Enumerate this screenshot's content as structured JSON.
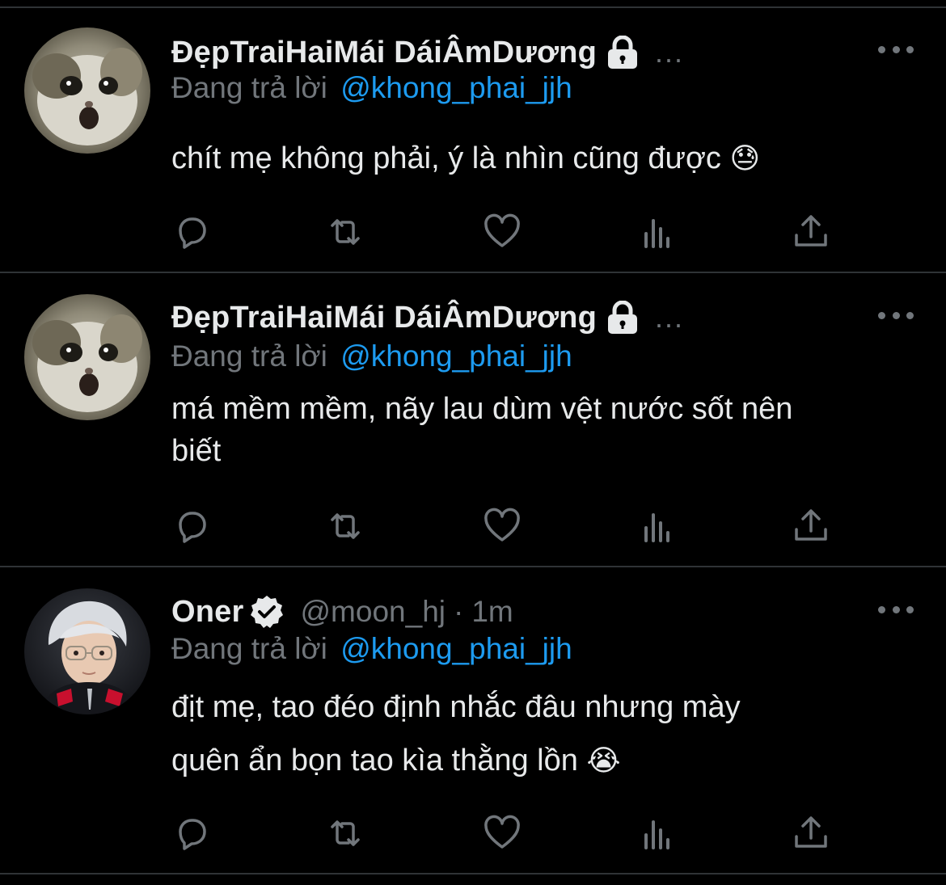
{
  "tweets": [
    {
      "name": "ĐẹpTraiHaiMái DáiÂmDương",
      "ellipsis": "...",
      "reply_prefix": "Đang trả lời",
      "reply_to": "@khong_phai_jjh",
      "text": "chít mẹ không phải, ý là nhìn cũng được",
      "emoji": "😓",
      "avatar_icon": "cat-avatar",
      "locked": true
    },
    {
      "name": "ĐẹpTraiHaiMái DáiÂmDương",
      "ellipsis": "...",
      "reply_prefix": "Đang trả lời",
      "reply_to": "@khong_phai_jjh",
      "text_line1": "má mềm mềm, nãy lau dùm vệt nước sốt nên",
      "text_line2": "biết",
      "avatar_icon": "cat-avatar",
      "locked": true
    },
    {
      "name": "Oner",
      "handle": "@moon_hj",
      "dot": "·",
      "time": "1m",
      "reply_prefix": "Đang trả lời",
      "reply_to": "@khong_phai_jjh",
      "text_line1": "địt mẹ, tao đéo định nhắc đâu nhưng mày",
      "text_line2": "quên ẩn bọn tao kìa thằng lồn",
      "emoji": "😭",
      "avatar_icon": "person-avatar",
      "verified": true
    }
  ],
  "colors": {
    "background": "#000000",
    "text": "#e7e9ea",
    "secondary": "#71767b",
    "mention": "#1d9bf0",
    "divider": "#2f3336"
  },
  "action_icons": [
    "reply-icon",
    "retweet-icon",
    "like-icon",
    "views-icon",
    "share-icon"
  ]
}
